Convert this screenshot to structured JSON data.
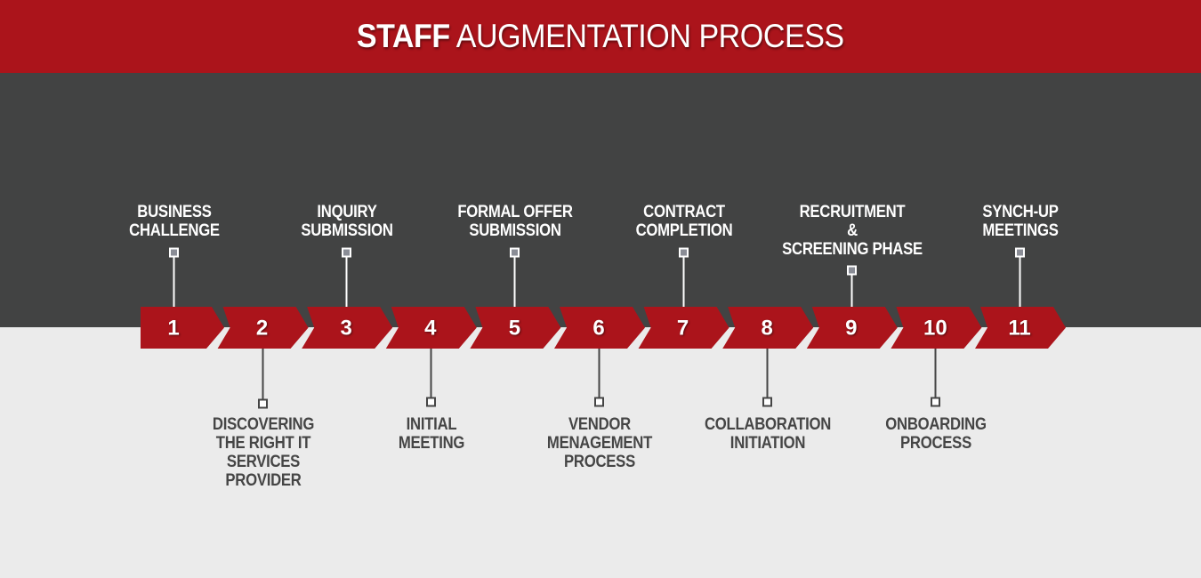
{
  "header": {
    "title_bold": "STAFF",
    "title_rest": "AUGMENTATION PROCESS"
  },
  "colors": {
    "header_bg": "#ab141b",
    "chevron": "#ab141b",
    "dark_band": "#424343",
    "light_band": "#ebebeb",
    "top_marker_fill": "#8a8d96",
    "bottom_marker_fill": "#ffffff"
  },
  "steps": [
    {
      "number": "1",
      "label": [
        "BUSINESS",
        "CHALLENGE"
      ],
      "position": "top"
    },
    {
      "number": "2",
      "label": [
        "DISCOVERING",
        "THE RIGHT IT",
        "SERVICES",
        "PROVIDER"
      ],
      "position": "bottom"
    },
    {
      "number": "3",
      "label": [
        "INQUIRY",
        "SUBMISSION"
      ],
      "position": "top"
    },
    {
      "number": "4",
      "label": [
        "INITIAL",
        "MEETING"
      ],
      "position": "bottom"
    },
    {
      "number": "5",
      "label": [
        "FORMAL OFFER",
        "SUBMISSION"
      ],
      "position": "top"
    },
    {
      "number": "6",
      "label": [
        "VENDOR",
        "MENAGEMENT",
        "PROCESS"
      ],
      "position": "bottom"
    },
    {
      "number": "7",
      "label": [
        "CONTRACT",
        "COMPLETION"
      ],
      "position": "top"
    },
    {
      "number": "8",
      "label": [
        "COLLABORATION",
        "INITIATION"
      ],
      "position": "bottom"
    },
    {
      "number": "9",
      "label": [
        "RECRUITMENT",
        "&",
        "SCREENING PHASE"
      ],
      "position": "top"
    },
    {
      "number": "10",
      "label": [
        "ONBOARDING",
        "PROCESS"
      ],
      "position": "bottom"
    },
    {
      "number": "11",
      "label": [
        "SYNCH-UP",
        "MEETINGS"
      ],
      "position": "top"
    }
  ]
}
